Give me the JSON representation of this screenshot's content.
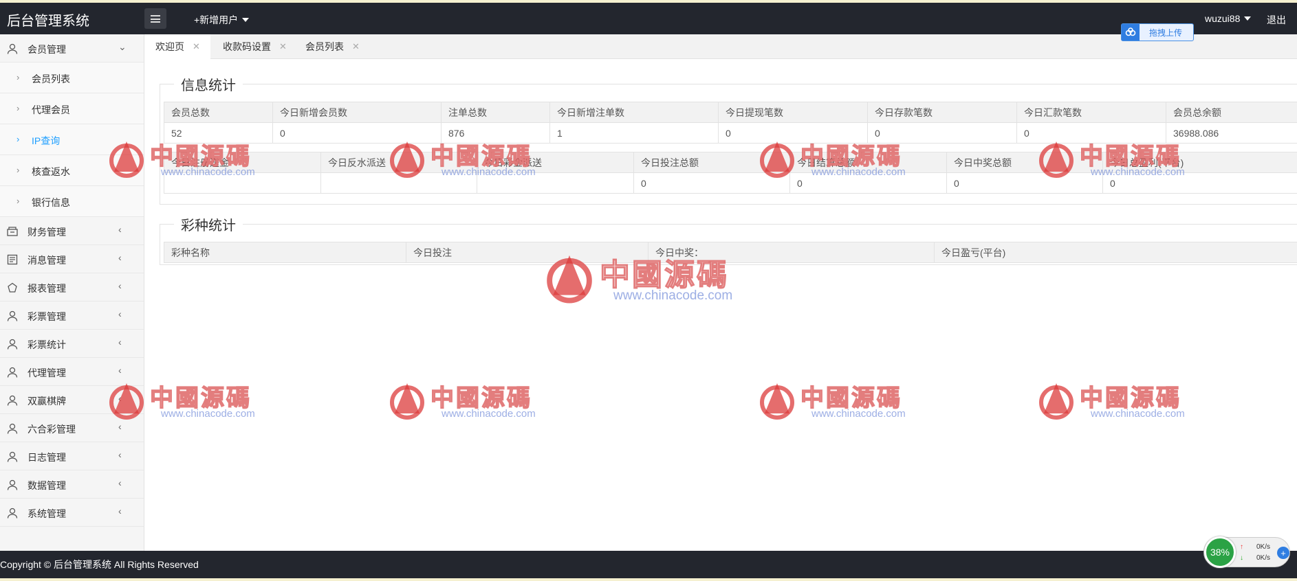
{
  "header": {
    "brand": "后台管理系统",
    "add_user": "+新增用户",
    "username": "wuzui88",
    "logout": "退出",
    "upload_label": "拖拽上传"
  },
  "sidebar": {
    "groups": [
      {
        "label": "会员管理",
        "icon": "user-icon",
        "expanded": true,
        "children": [
          "会员列表",
          "代理会员",
          "IP查询",
          "核查返水",
          "银行信息"
        ],
        "active_child": "IP查询"
      },
      {
        "label": "财务管理",
        "icon": "finance-icon"
      },
      {
        "label": "消息管理",
        "icon": "message-icon"
      },
      {
        "label": "报表管理",
        "icon": "report-icon"
      },
      {
        "label": "彩票管理",
        "icon": "user-icon"
      },
      {
        "label": "彩票统计",
        "icon": "user-icon"
      },
      {
        "label": "代理管理",
        "icon": "user-icon"
      },
      {
        "label": "双赢棋牌",
        "icon": "user-icon"
      },
      {
        "label": "六合彩管理",
        "icon": "user-icon"
      },
      {
        "label": "日志管理",
        "icon": "user-icon"
      },
      {
        "label": "数据管理",
        "icon": "user-icon"
      },
      {
        "label": "系统管理",
        "icon": "user-icon"
      }
    ]
  },
  "tabs": [
    {
      "label": "欢迎页",
      "active": true
    },
    {
      "label": "收款码设置",
      "active": false
    },
    {
      "label": "会员列表",
      "active": false
    }
  ],
  "info_stats": {
    "title": "信息统计",
    "row1_headers": [
      "会员总数",
      "今日新增会员数",
      "注单总数",
      "今日新增注单数",
      "今日提现笔数",
      "今日存款笔数",
      "今日汇款笔数",
      "会员总余额"
    ],
    "row1_values": [
      "52",
      "0",
      "876",
      "1",
      "0",
      "0",
      "0",
      "36988.086"
    ],
    "row2_headers": [
      "今日注册送金",
      "今日反水派送",
      "今日彩金派送",
      "今日投注总额",
      "今日结算总额",
      "今日中奖总额",
      "今日总盈利(平台)"
    ],
    "row2_values": [
      "",
      "",
      "",
      "0",
      "0",
      "0",
      "0"
    ]
  },
  "lottery_stats": {
    "title": "彩种统计",
    "headers": [
      "彩种名称",
      "今日投注",
      "今日中奖：",
      "今日盈亏(平台)"
    ]
  },
  "footer": {
    "copyright": "Copyright © 后台管理系统 All Rights Reserved"
  },
  "speed_widget": {
    "percent": "38%",
    "upload": "0K/s",
    "download": "0K/s"
  },
  "watermark": {
    "text": "中國源碼",
    "url": "www.chinacode.com"
  },
  "colors": {
    "header_bg": "#23262e",
    "active_link": "#1e9fff",
    "widget_green": "#2ba245"
  }
}
